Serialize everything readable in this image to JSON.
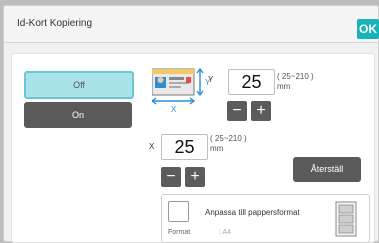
{
  "window": {
    "title": "Id-Kort Kopiering",
    "ok_label": "OK"
  },
  "mode": {
    "off_label": "Off",
    "on_label": "On"
  },
  "y_size": {
    "axis": "Y",
    "value": "25",
    "range": "( 25~210 )",
    "unit": "mm"
  },
  "x_size": {
    "axis": "X",
    "value": "25",
    "range": "( 25~210 )",
    "unit": "mm"
  },
  "card_icon": {
    "axis_x": "X",
    "axis_y": "Y"
  },
  "steppers": {
    "minus": "−",
    "plus": "+"
  },
  "reset_label": "Återställ",
  "fit": {
    "label": "Anpassa till pappersformat",
    "format_label": "Format",
    "format_value": ": A4",
    "checked": false
  },
  "colors": {
    "accent": "#17b3b7",
    "selected_bg": "#a8e3ea",
    "dark_button": "#5a5a5a"
  },
  "icons": [
    "card-size-icon",
    "paper-icon"
  ]
}
